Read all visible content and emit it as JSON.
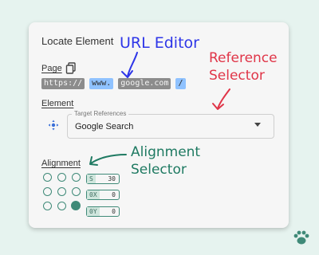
{
  "card": {
    "title": "Locate Element",
    "page_label": "Page",
    "url_parts": [
      "https://",
      "www.",
      "google.com",
      "/"
    ],
    "element_label": "Element",
    "select": {
      "legend": "Target References",
      "value": "Google Search"
    },
    "alignment_label": "Alignment",
    "alignment_fields": [
      {
        "tag": "S",
        "value": "30"
      },
      {
        "tag": "0X",
        "value": "0"
      },
      {
        "tag": "0Y",
        "value": "0"
      }
    ]
  },
  "annotations": {
    "url_editor": "URL Editor",
    "reference_selector_line1": "Reference",
    "reference_selector_line2": "Selector",
    "alignment_selector_line1": "Alignment",
    "alignment_selector_line2": "Selector"
  },
  "colors": {
    "background": "#e6f3ef",
    "accent_green": "#3f8a78",
    "annotation_blue": "#2e36e8",
    "annotation_red": "#e03548",
    "annotation_green": "#1f7a62"
  },
  "icons": [
    "copy-icon",
    "target-icon",
    "chevron-down-icon",
    "paw-icon"
  ]
}
